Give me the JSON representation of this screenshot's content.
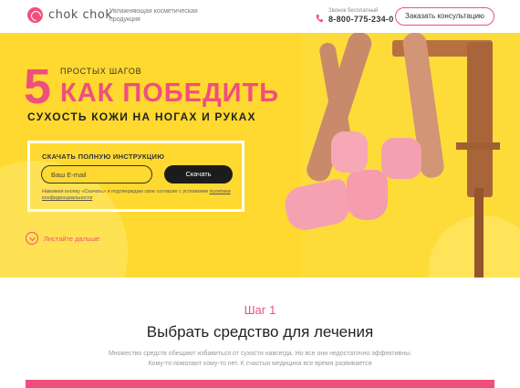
{
  "brand": {
    "name": "chok chok",
    "tagline": "Увлажняющая косметическая продукция",
    "accent_color": "#f04f7d",
    "hero_color": "#ffd92f"
  },
  "header": {
    "phone_caption": "Звонок бесплатный",
    "phone_number": "8-800-775-234-0",
    "consult_button": "Заказать консультацию"
  },
  "hero": {
    "big_number": "5",
    "steps_label": "ПРОСТЫХ ШАГОВ",
    "headline": "КАК ПОБЕДИТЬ",
    "subheadline": "СУХОСТЬ КОЖИ НА НОГАХ И РУКАХ",
    "form": {
      "title": "СКАЧАТЬ ПОЛНУЮ ИНСТРУКЦИЮ",
      "email_placeholder": "Ваш E-mail",
      "download_button": "Скачать",
      "consent_text": "Нажимая кнопку «Скачать» я подтверждаю свое согласие с условиями",
      "consent_link": "политики конфиденциальности"
    },
    "scroll_text": "Листайте дальше"
  },
  "step": {
    "label": "Шаг 1",
    "title": "Выбрать средство для лечения",
    "description_line1": "Множество средств обещают избавиться от сухости навсегда. Но все они недостаточно эффективны.",
    "description_line2": "Кому-то помогают кому-то нет. К счастью медицина все время развивается"
  },
  "icons": [
    "logo-icon",
    "phone-icon",
    "chevron-down-icon"
  ]
}
